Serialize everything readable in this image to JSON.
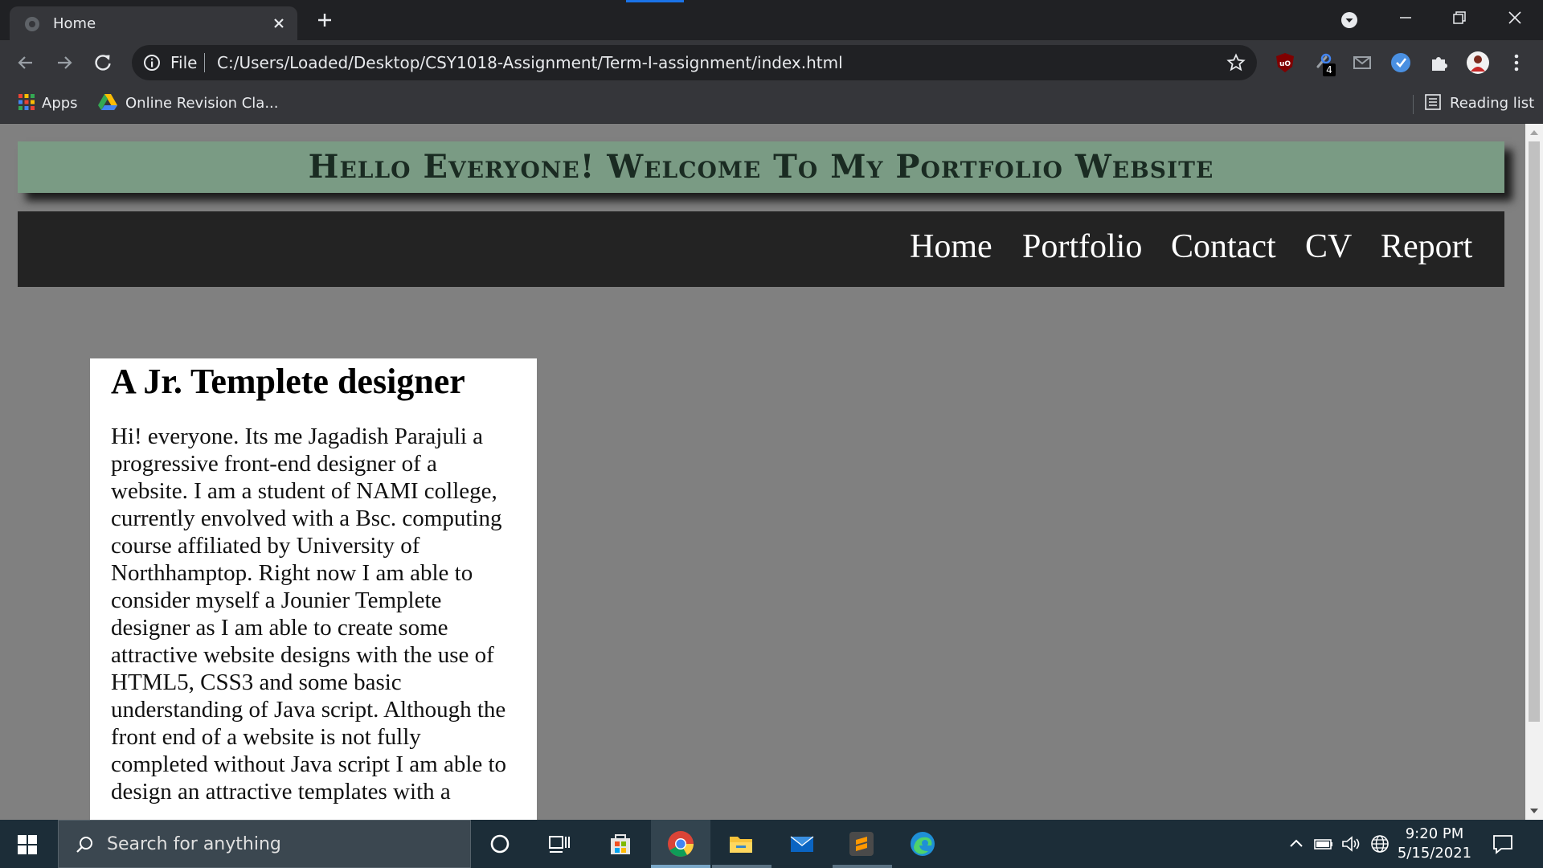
{
  "browser": {
    "tab_title": "Home",
    "address_scheme": "File",
    "address_url": "C:/Users/Loaded/Desktop/CSY1018-Assignment/Term-I-assignment/index.html",
    "extension_badge": "4",
    "bookmarks": {
      "apps": "Apps",
      "online_revision": "Online Revision Cla...",
      "reading_list": "Reading list"
    }
  },
  "site": {
    "header_title": "Hello Everyone! Welcome To My Portfolio Website",
    "nav": [
      "Home",
      "Portfolio",
      "Contact",
      "CV",
      "Report"
    ],
    "card": {
      "heading": "A Jr. Templete designer",
      "body": "Hi! everyone. Its me Jagadish Parajuli a progressive front-end designer of a website. I am a student of NAMI college, currently envolved with a Bsc. computing course affiliated by University of Northhamptop. Right now I am able to consider myself a Jounier Templete designer as I am able to create some attractive website designs with the use of HTML5, CSS3 and some basic understanding of Java script. Although the front end of a website is not fully completed without Java script I am able to design an attractive templates with a"
    },
    "colors": {
      "page_bg": "#808080",
      "header_bg": "#7a9b84",
      "nav_bg": "#232323",
      "card_bg": "#ffffff"
    }
  },
  "taskbar": {
    "search_placeholder": "Search for anything",
    "time": "9:20 PM",
    "date": "5/15/2021",
    "pinned_icons": [
      "cortana-icon",
      "task-view-icon",
      "store-icon",
      "chrome-icon",
      "file-explorer-icon",
      "mail-icon",
      "sublime-text-icon",
      "edge-icon"
    ]
  }
}
